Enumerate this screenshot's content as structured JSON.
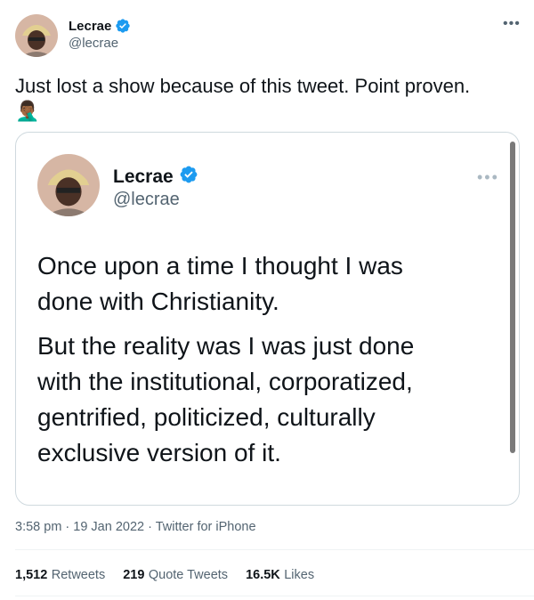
{
  "author": {
    "name": "Lecrae",
    "handle": "@lecrae"
  },
  "tweet": {
    "text": "Just lost a show because of this tweet. Point proven.",
    "emoji": "🤦🏾‍♂️",
    "timestamp": "3:58 pm · 19 Jan 2022 · Twitter for iPhone"
  },
  "quoted": {
    "name": "Lecrae",
    "handle": "@lecrae",
    "paragraph1": [
      "Once upon a time I thought I was",
      "done with Christianity."
    ],
    "paragraph2": [
      "But the reality was I was just done",
      "with the institutional, corporatized,",
      "gentrified, politicized, culturally",
      "exclusive version of it."
    ]
  },
  "stats": {
    "retweets_count": "1,512",
    "retweets_label": "Retweets",
    "quote_count": "219",
    "quote_label": "Quote Tweets",
    "likes_count": "16.5K",
    "likes_label": "Likes"
  },
  "colors": {
    "verified": "#1d9bf0",
    "muted": "#536471",
    "border": "#cfd9de"
  }
}
